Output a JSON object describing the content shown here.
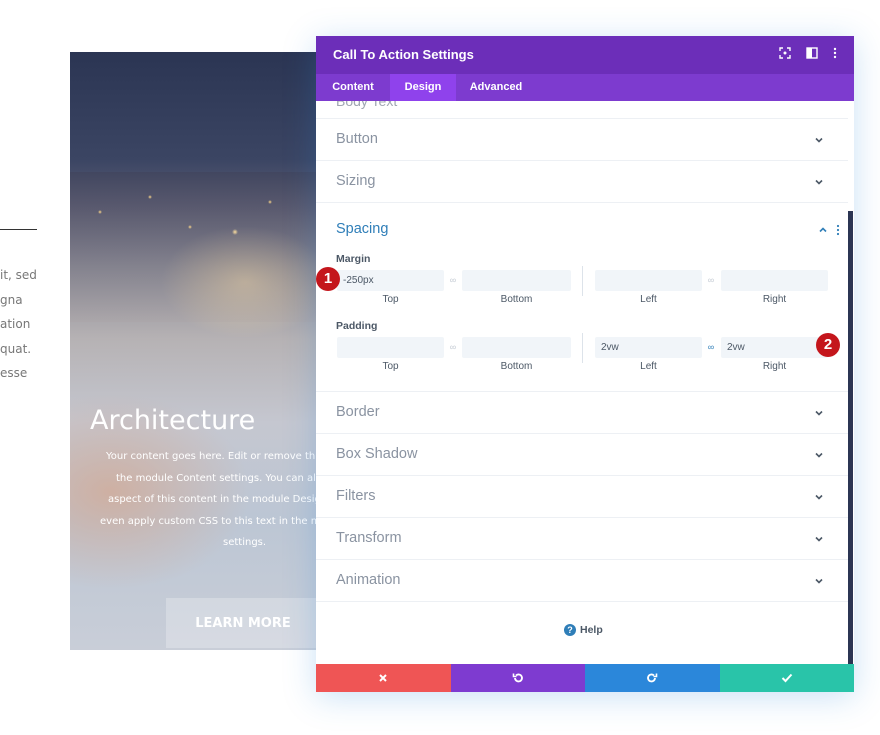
{
  "background_page": {
    "left_text_lines": [
      "it, sed",
      "gna",
      "ation",
      "quat.",
      "esse"
    ],
    "hero": {
      "title": "Architecture",
      "body_lines": [
        "Your content goes here. Edit or remove this t",
        "the module Content settings. You can also",
        "aspect of this content in the module Design",
        "even apply custom CSS to this text in the mo",
        "settings."
      ],
      "button_label": "LEARN MORE"
    }
  },
  "modal": {
    "title": "Call To Action Settings",
    "header_icons": [
      "fullscreen-icon",
      "split-view-icon",
      "more-options-icon"
    ],
    "tabs": [
      {
        "label": "Content",
        "active": false
      },
      {
        "label": "Design",
        "active": true
      },
      {
        "label": "Advanced",
        "active": false
      }
    ],
    "cut_off_label": "Body Text",
    "toggles_above": [
      {
        "label": "Button",
        "state": "collapsed"
      },
      {
        "label": "Sizing",
        "state": "collapsed"
      }
    ],
    "spacing": {
      "label": "Spacing",
      "state": "expanded",
      "margin": {
        "label": "Margin",
        "top": {
          "value": "-250px",
          "caption": "Top"
        },
        "bottom": {
          "value": "",
          "caption": "Bottom"
        },
        "left": {
          "value": "",
          "caption": "Left"
        },
        "right": {
          "value": "",
          "caption": "Right"
        }
      },
      "padding": {
        "label": "Padding",
        "top": {
          "value": "",
          "caption": "Top"
        },
        "bottom": {
          "value": "",
          "caption": "Bottom"
        },
        "left": {
          "value": "2vw",
          "caption": "Left"
        },
        "right": {
          "value": "2vw",
          "caption": "Right"
        },
        "left_right_linked": true
      }
    },
    "toggles_below": [
      {
        "label": "Border",
        "state": "collapsed"
      },
      {
        "label": "Box Shadow",
        "state": "collapsed"
      },
      {
        "label": "Filters",
        "state": "collapsed"
      },
      {
        "label": "Transform",
        "state": "collapsed"
      },
      {
        "label": "Animation",
        "state": "collapsed"
      }
    ],
    "help_label": "Help",
    "footer_buttons": [
      "close-icon",
      "undo-icon",
      "redo-icon",
      "check-icon"
    ]
  },
  "annotations": {
    "badge_1": "1",
    "badge_2": "2"
  },
  "colors": {
    "header_purple": "#6c2eb9",
    "tab_bar_purple": "#7d3bcf",
    "active_tab": "#8f42ec",
    "accent_blue": "#2f7eb8",
    "cancel_red": "#ef5555",
    "undo_purple": "#7e3bd0",
    "redo_blue": "#2b87da",
    "save_teal": "#29c4a9",
    "badge_red": "#c4161c"
  }
}
